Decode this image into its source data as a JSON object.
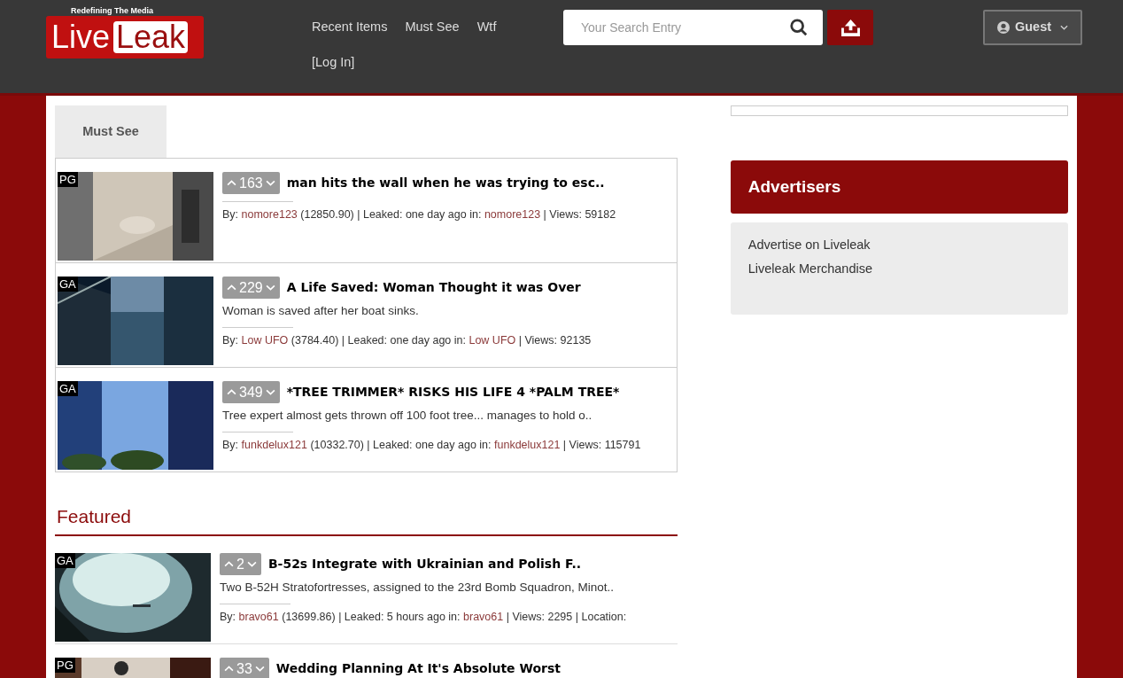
{
  "header": {
    "logo": {
      "tagline": "Redefining The Media",
      "word_1": "Live",
      "word_2": "Leak"
    },
    "nav": [
      {
        "label": "Recent Items"
      },
      {
        "label": "Must See"
      },
      {
        "label": "Wtf"
      },
      {
        "label": "[Log In]"
      }
    ],
    "search": {
      "placeholder": "Your Search Entry"
    },
    "user_menu": {
      "label": "Guest"
    }
  },
  "tabs": [
    {
      "label": "Must See",
      "selected": true
    }
  ],
  "must_see": [
    {
      "rating": "PG",
      "votes": "163",
      "title": "man hits the wall when he was trying to esc..",
      "meta": [
        {
          "kind": "text",
          "text": "By:"
        },
        {
          "kind": "link",
          "text": "nomore123"
        },
        {
          "kind": "text",
          "text": "(12850.90) | Leaked: one day ago in:"
        },
        {
          "kind": "link",
          "text": "nomore123"
        },
        {
          "kind": "text",
          "text": "| Views: 59182"
        }
      ]
    },
    {
      "rating": "GA",
      "votes": "229",
      "title": "A Life Saved: Woman Thought it was Over",
      "description": "Woman is saved after her boat sinks.",
      "meta": [
        {
          "kind": "text",
          "text": "By:"
        },
        {
          "kind": "link",
          "text": "Low UFO"
        },
        {
          "kind": "text",
          "text": "(3784.40) | Leaked: one day ago in:"
        },
        {
          "kind": "link",
          "text": "Low UFO"
        },
        {
          "kind": "text",
          "text": "| Views: 92135"
        }
      ]
    },
    {
      "rating": "GA",
      "votes": "349",
      "title": "*TREE TRIMMER* RISKS HIS LIFE 4 *PALM TREE*",
      "description": "Tree expert almost gets thrown off 100 foot tree... manages to hold o..",
      "meta": [
        {
          "kind": "text",
          "text": "By:"
        },
        {
          "kind": "link",
          "text": "funkdelux121"
        },
        {
          "kind": "text",
          "text": "(10332.70) | Leaked: one day ago in:"
        },
        {
          "kind": "link",
          "text": "funkdelux121"
        },
        {
          "kind": "text",
          "text": "| Views: 115791"
        }
      ]
    }
  ],
  "featured": {
    "heading": "Featured",
    "items": [
      {
        "rating": "GA",
        "votes": "2",
        "title": "B-52s Integrate with Ukrainian and Polish F..",
        "description": "Two B-52H Stratofortresses, assigned to the 23rd Bomb Squadron, Minot..",
        "meta": [
          {
            "kind": "text",
            "text": "By:"
          },
          {
            "kind": "link",
            "text": "bravo61"
          },
          {
            "kind": "text",
            "text": "(13699.86) | Leaked: 5 hours ago in:"
          },
          {
            "kind": "link",
            "text": "bravo61"
          },
          {
            "kind": "text",
            "text": "| Views: 2295 | Location:"
          }
        ]
      },
      {
        "rating": "PG",
        "votes": "33",
        "title": "Wedding Planning At It's Absolute Worst"
      }
    ]
  },
  "advertisers": {
    "heading": "Advertisers",
    "links": [
      {
        "label": "Advertise on Liveleak"
      },
      {
        "label": "Liveleak Merchandise"
      }
    ]
  }
}
